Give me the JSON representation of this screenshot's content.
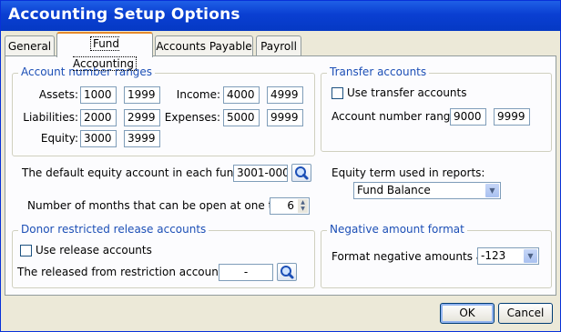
{
  "window": {
    "title": "Accounting Setup Options",
    "close_glyph": "✕"
  },
  "tabs": [
    {
      "label": "General"
    },
    {
      "label": "Fund Accounting"
    },
    {
      "label": "Accounts Payable"
    },
    {
      "label": "Payroll"
    }
  ],
  "account_ranges": {
    "legend": "Account number ranges",
    "assets": {
      "label": "Assets:",
      "from": "1000",
      "to": "1999"
    },
    "liabilities": {
      "label": "Liabilities:",
      "from": "2000",
      "to": "2999"
    },
    "equity": {
      "label": "Equity:",
      "from": "3000",
      "to": "3999"
    },
    "income": {
      "label": "Income:",
      "from": "4000",
      "to": "4999"
    },
    "expenses": {
      "label": "Expenses:",
      "from": "5000",
      "to": "9999"
    }
  },
  "transfer": {
    "legend": "Transfer accounts",
    "checkbox_label": "Use transfer accounts",
    "range_label": "Account number range:",
    "from": "9000",
    "to": "9999"
  },
  "default_equity": {
    "label": "The default equity account in each fund is:",
    "value": "3001-000"
  },
  "months_open": {
    "label": "Number of months that can be open at one time:",
    "value": "6"
  },
  "equity_term": {
    "label": "Equity term used in reports:",
    "value": "Fund Balance"
  },
  "donor": {
    "legend": "Donor restricted release accounts",
    "checkbox_label": "Use release accounts",
    "released_label": "The released from restriction account is:",
    "released_value": "-"
  },
  "negative": {
    "legend": "Negative amount format",
    "label": "Format negative amounts as:",
    "value": "-123"
  },
  "buttons": {
    "ok": "OK",
    "cancel": "Cancel"
  }
}
